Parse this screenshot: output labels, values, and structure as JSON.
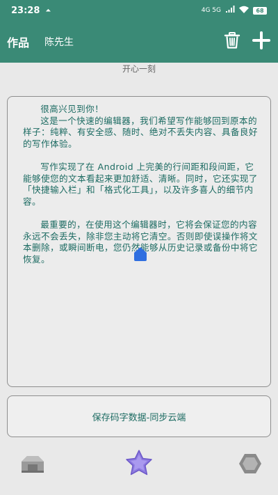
{
  "status_bar": {
    "time": "23:28",
    "network": "4G 5G",
    "battery": "68"
  },
  "app_bar": {
    "title": "作品",
    "author": "陈先生",
    "delete_icon": "trash-icon",
    "add_icon": "plus-icon"
  },
  "subtitle": "开心一刻",
  "editor": {
    "paragraphs": [
      "很高兴见到你！",
      "这是一个快速的编辑器，我们希望写作能够回到原本的样子：纯粹、有安全感、随时、绝对不丢失内容、具备良好的写作体验。",
      "写作实现了在 Android 上完美的行间距和段间距，它能够使您的文本看起来更加舒适、清晰。同时，它还实现了「快捷输入栏」和「格式化工具」，以及许多喜人的细节内容。",
      "最重要的，在使用这个编辑器时，它将会保证您的内容永远不会丢失，除非您主动将它清空。否则即使误操作将文本删除，或瞬间断电，您仍然能够从历史记录或备份中将它恢复。"
    ]
  },
  "save_button": {
    "label": "保存码字数据-同步云端"
  },
  "bottom_nav": {
    "items": [
      "house-icon",
      "star-icon",
      "hexagon-icon"
    ]
  },
  "colors": {
    "accent": "#3a8a76",
    "text": "#1c6b62",
    "caret": "#2f6fe0",
    "star": "#8e7be0"
  }
}
